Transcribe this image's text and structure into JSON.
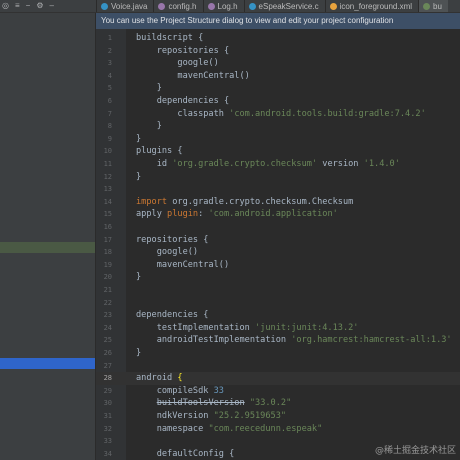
{
  "toolbar": {
    "icons": [
      "target-icon",
      "expand-icon",
      "collapse-icon",
      "gear-icon",
      "minimize-icon"
    ]
  },
  "tabs": [
    {
      "label": "Voice.java",
      "icon": "java-file-icon",
      "color": "#3592c4"
    },
    {
      "label": "config.h",
      "icon": "header-file-icon",
      "color": "#9876aa"
    },
    {
      "label": "Log.h",
      "icon": "header-file-icon",
      "color": "#9876aa"
    },
    {
      "label": "eSpeakService.c",
      "icon": "c-file-icon",
      "color": "#3592c4"
    },
    {
      "label": "icon_foreground.xml",
      "icon": "xml-file-icon",
      "color": "#e8a33d"
    },
    {
      "label": "bu",
      "icon": "gradle-file-icon",
      "color": "#6a8759",
      "selected": true
    }
  ],
  "banner": {
    "text": "You can use the Project Structure dialog to view and edit your project configuration"
  },
  "editor": {
    "current_line": 28,
    "lines": [
      {
        "n": "1",
        "t": [
          [
            "plain",
            "buildscript {"
          ]
        ]
      },
      {
        "n": "2",
        "t": [
          [
            "plain",
            "    repositories {"
          ]
        ]
      },
      {
        "n": "3",
        "t": [
          [
            "plain",
            "        google()"
          ]
        ]
      },
      {
        "n": "4",
        "t": [
          [
            "plain",
            "        mavenCentral()"
          ]
        ]
      },
      {
        "n": "5",
        "t": [
          [
            "plain",
            "    }"
          ]
        ]
      },
      {
        "n": "6",
        "t": [
          [
            "plain",
            "    dependencies {"
          ]
        ]
      },
      {
        "n": "7",
        "t": [
          [
            "plain",
            "        classpath "
          ],
          [
            "str",
            "'com.android.tools.build:gradle:7.4.2'"
          ]
        ]
      },
      {
        "n": "8",
        "t": [
          [
            "plain",
            "    }"
          ]
        ]
      },
      {
        "n": "9",
        "t": [
          [
            "plain",
            "}"
          ]
        ]
      },
      {
        "n": "10",
        "t": [
          [
            "plain",
            "plugins {"
          ]
        ]
      },
      {
        "n": "11",
        "t": [
          [
            "plain",
            "    id "
          ],
          [
            "str",
            "'org.gradle.crypto.checksum'"
          ],
          [
            "plain",
            " version "
          ],
          [
            "str",
            "'1.4.0'"
          ]
        ]
      },
      {
        "n": "12",
        "t": [
          [
            "plain",
            "}"
          ]
        ]
      },
      {
        "n": "13",
        "t": []
      },
      {
        "n": "14",
        "t": [
          [
            "kw",
            "import "
          ],
          [
            "plain",
            "org.gradle.crypto.checksum.Checksum"
          ]
        ]
      },
      {
        "n": "15",
        "t": [
          [
            "plain",
            "apply "
          ],
          [
            "kw",
            "plugin"
          ],
          [
            "plain",
            ": "
          ],
          [
            "str",
            "'com.android.application'"
          ]
        ]
      },
      {
        "n": "16",
        "t": []
      },
      {
        "n": "17",
        "t": [
          [
            "plain",
            "repositories {"
          ]
        ]
      },
      {
        "n": "18",
        "t": [
          [
            "plain",
            "    google()"
          ]
        ]
      },
      {
        "n": "19",
        "t": [
          [
            "plain",
            "    mavenCentral()"
          ]
        ]
      },
      {
        "n": "20",
        "t": [
          [
            "plain",
            "}"
          ]
        ]
      },
      {
        "n": "21",
        "t": []
      },
      {
        "n": "22",
        "t": []
      },
      {
        "n": "23",
        "t": [
          [
            "plain",
            "dependencies {"
          ]
        ]
      },
      {
        "n": "24",
        "t": [
          [
            "plain",
            "    testImplementation "
          ],
          [
            "str",
            "'junit:junit:4.13.2'"
          ]
        ]
      },
      {
        "n": "25",
        "t": [
          [
            "plain",
            "    androidTestImplementation "
          ],
          [
            "str",
            "'org.hamcrest:hamcrest-all:1.3'"
          ]
        ]
      },
      {
        "n": "26",
        "t": [
          [
            "plain",
            "}"
          ]
        ]
      },
      {
        "n": "27",
        "t": []
      },
      {
        "n": "28",
        "t": [
          [
            "plain",
            "android "
          ],
          [
            "brace",
            "{"
          ]
        ]
      },
      {
        "n": "29",
        "t": [
          [
            "plain",
            "    compileSdk "
          ],
          [
            "num",
            "33"
          ]
        ]
      },
      {
        "n": "30",
        "t": [
          [
            "plain",
            "    "
          ],
          [
            "strike",
            "buildToolsVersion"
          ],
          [
            "plain",
            " "
          ],
          [
            "str",
            "\"33.0.2\""
          ]
        ]
      },
      {
        "n": "31",
        "t": [
          [
            "plain",
            "    ndkVersion "
          ],
          [
            "str",
            "\"25.2.9519653\""
          ]
        ]
      },
      {
        "n": "32",
        "t": [
          [
            "plain",
            "    namespace "
          ],
          [
            "str",
            "\"com.reecedunn.espeak\""
          ]
        ]
      },
      {
        "n": "33",
        "t": []
      },
      {
        "n": "34",
        "t": [
          [
            "plain",
            "    defaultConfig {"
          ]
        ]
      }
    ]
  },
  "watermark": "@稀土掘金技术社区"
}
